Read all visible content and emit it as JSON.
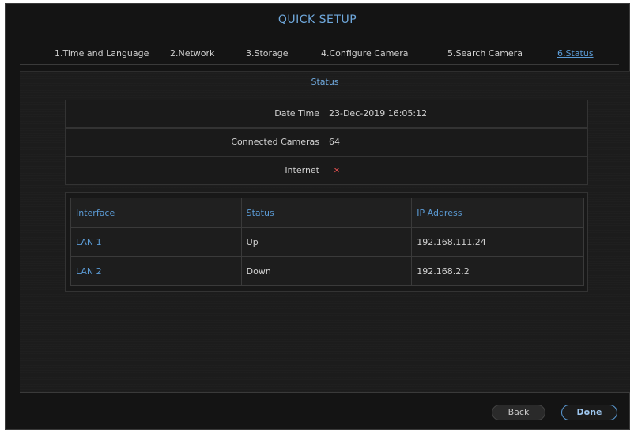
{
  "window": {
    "title": "QUICK SETUP"
  },
  "tabs": [
    {
      "label": "1.Time and Language",
      "active": false
    },
    {
      "label": "2.Network",
      "active": false
    },
    {
      "label": "3.Storage",
      "active": false
    },
    {
      "label": "4.Configure Camera",
      "active": false
    },
    {
      "label": "5.Search Camera",
      "active": false
    },
    {
      "label": "6.Status",
      "active": true
    }
  ],
  "status": {
    "title": "Status",
    "date_time": {
      "label": "Date Time",
      "value": "23-Dec-2019 16:05:12"
    },
    "connected_cameras": {
      "label": "Connected Cameras",
      "value": "64"
    },
    "internet": {
      "label": "Internet",
      "value_icon": "x-icon",
      "value_color": "#e05050"
    }
  },
  "interfaces": {
    "headers": [
      "Interface",
      "Status",
      "IP Address"
    ],
    "rows": [
      {
        "interface": "LAN 1",
        "status": "Up",
        "ip": "192.168.111.24"
      },
      {
        "interface": "LAN 2",
        "status": "Down",
        "ip": "192.168.2.2"
      }
    ]
  },
  "buttons": {
    "back": "Back",
    "done": "Done"
  },
  "colors": {
    "accent": "#5b9bd5",
    "background": "#141414",
    "error": "#e05050"
  }
}
